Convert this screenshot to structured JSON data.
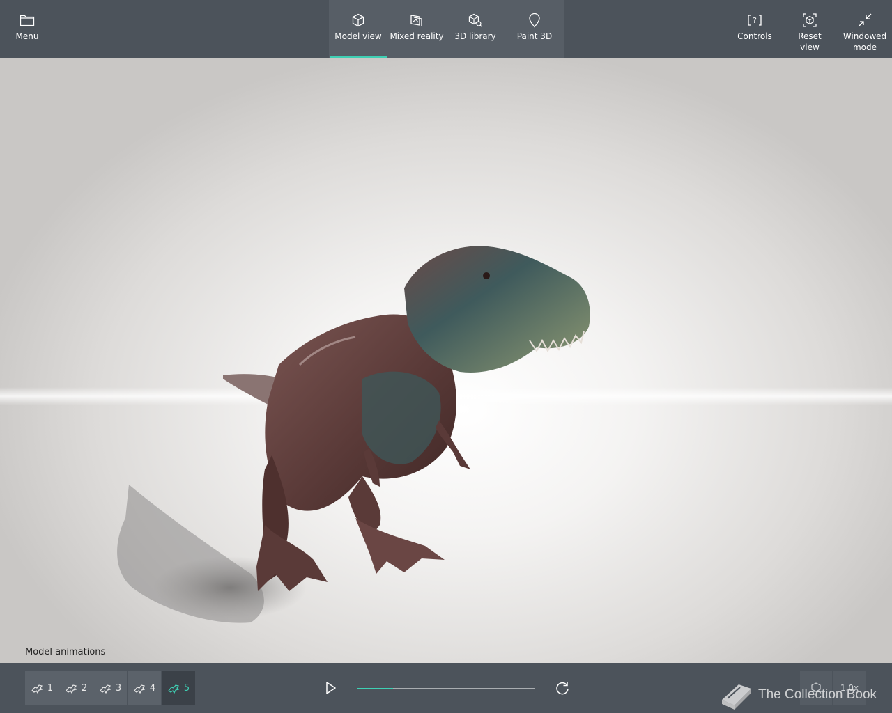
{
  "topbar": {
    "menu": {
      "label": "Menu",
      "icon": "folder-icon"
    },
    "tabs": [
      {
        "label": "Model view",
        "icon": "cube-icon",
        "active": true
      },
      {
        "label": "Mixed reality",
        "icon": "mixed-reality-icon",
        "active": false
      },
      {
        "label": "3D library",
        "icon": "library-icon",
        "active": false
      },
      {
        "label": "Paint 3D",
        "icon": "paint-3d-icon",
        "active": false
      }
    ],
    "right": [
      {
        "label": "Controls",
        "icon": "controls-icon"
      },
      {
        "label": "Reset view",
        "icon": "reset-view-icon"
      },
      {
        "label": "Windowed mode",
        "label_line1": "Windowed",
        "label_line2": "mode",
        "icon": "windowed-mode-icon"
      }
    ]
  },
  "viewport": {
    "model": "dinosaur-model"
  },
  "animations": {
    "label": "Model animations",
    "items": [
      {
        "label": "1",
        "active": false
      },
      {
        "label": "2",
        "active": false
      },
      {
        "label": "3",
        "active": false
      },
      {
        "label": "4",
        "active": false
      },
      {
        "label": "5",
        "active": true
      }
    ]
  },
  "playback": {
    "progress_fraction": 0.2,
    "play_icon": "play-icon",
    "loop_icon": "loop-icon"
  },
  "bottom_right": {
    "zoom": "1.0x",
    "view_icon": "environment-icon"
  },
  "watermark": {
    "text": "The Collection Book"
  },
  "colors": {
    "bar_bg": "#4c535b",
    "accent": "#3fd0b4"
  }
}
